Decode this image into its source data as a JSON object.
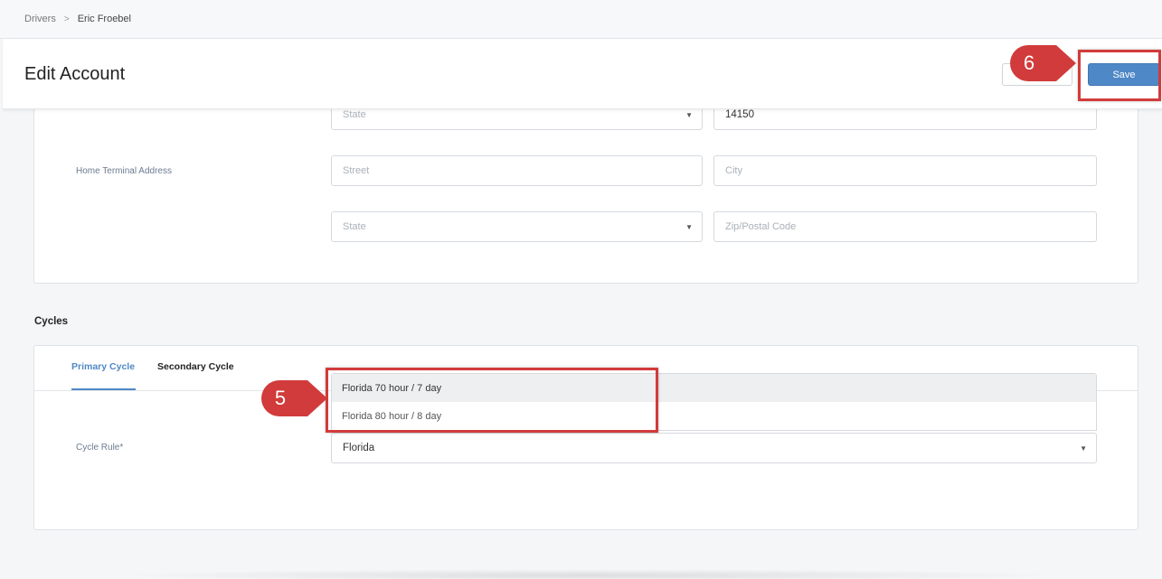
{
  "breadcrumb": {
    "parent": "Drivers",
    "separator": ">",
    "current": "Eric Froebel"
  },
  "header": {
    "title": "Edit Account",
    "cancel_label": "",
    "save_label": "Save"
  },
  "address_card": {
    "top_row": {
      "state_placeholder": "State",
      "zip_value": "14150"
    },
    "home_terminal": {
      "label": "Home Terminal Address",
      "street_placeholder": "Street",
      "city_placeholder": "City",
      "state_placeholder": "State",
      "zip_placeholder": "Zip/Postal Code"
    }
  },
  "cycles": {
    "section_title": "Cycles",
    "tabs": [
      {
        "label": "Primary Cycle",
        "active": true
      },
      {
        "label": "Secondary Cycle",
        "active": false
      }
    ],
    "cycle_rule": {
      "label": "Cycle Rule*",
      "value": "Florida",
      "options": [
        "Florida 70 hour / 7 day",
        "Florida 80 hour / 8 day"
      ]
    }
  },
  "annotations": {
    "callout_5": "5",
    "callout_6": "6"
  },
  "colors": {
    "accent": "#4f88c6",
    "callout_red": "#d13b3b"
  }
}
